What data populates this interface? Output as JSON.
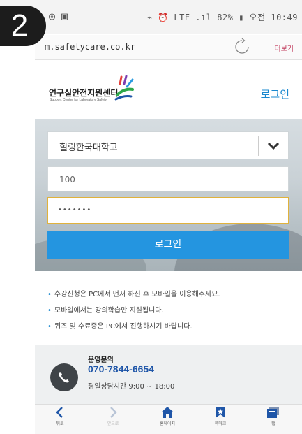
{
  "step_badge": "2",
  "status_bar": {
    "left": "◎ ▣",
    "right": "⌁ ⏰ LTE .ıl 82% ▮ 오전 10:49"
  },
  "address_bar": {
    "url": "m.safetycare.co.kr",
    "more_label": "더보기"
  },
  "header": {
    "logo_title": "연구실안전지원센터",
    "logo_subtitle": "Support Center for Laboratory Safety",
    "login_link": "로그인"
  },
  "login_form": {
    "school_select": "힐링한국대학교",
    "id_value": "100",
    "password_mask": "•••••••",
    "submit_label": "로그인"
  },
  "notices": [
    "수강신청은 PC에서 먼저 하신 후 모바일을 이용해주세요.",
    "모바일에서는 강의학습만 지원됩니다.",
    "퀴즈 및 수료증은 PC에서 진행하시기 바랍니다."
  ],
  "contact": {
    "title": "운영문의",
    "phone": "070-7844-6654",
    "hours": "평일상담시간 9:00 ~ 18:00"
  },
  "bottom_nav": {
    "back": "뒤로",
    "forward": "앞으로",
    "home": "홈페이지",
    "bookmark": "북마크",
    "tabs": "탭"
  },
  "colors": {
    "accent": "#2495e0",
    "link": "#1a88cf",
    "phone": "#1f56a8",
    "focus_border": "#e0b23c"
  }
}
